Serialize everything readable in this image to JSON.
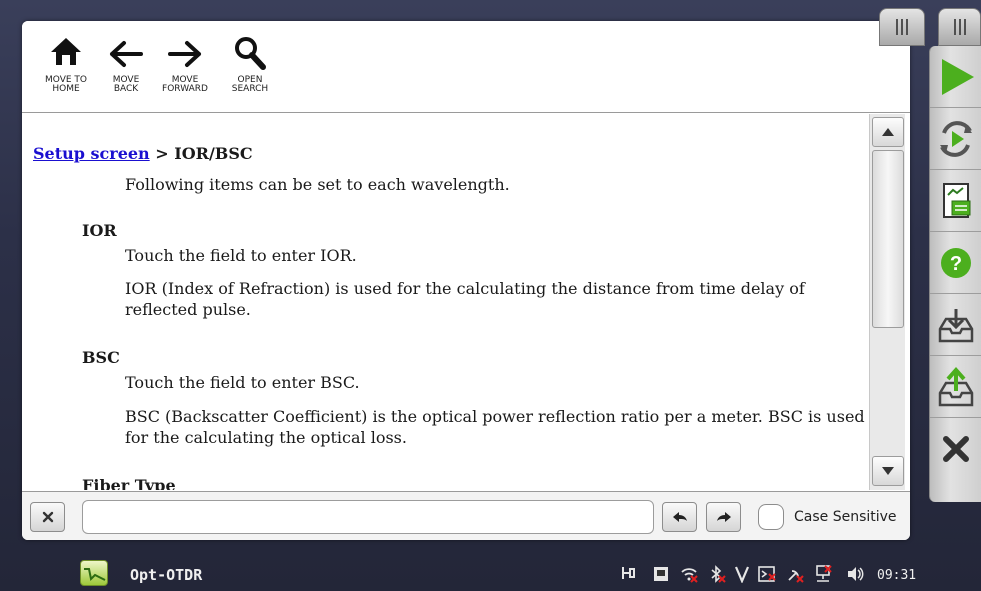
{
  "toolbar": {
    "home_label": "MOVE TO\nHOME",
    "back_label": "MOVE\nBACK",
    "forward_label": "MOVE\nFORWARD",
    "search_label": "OPEN\nSEARCH"
  },
  "content": {
    "breadcrumb_link": "Setup screen",
    "breadcrumb_rest": " > IOR/BSC",
    "intro": "Following items can be set to each wavelength.",
    "sections": [
      {
        "heading": "IOR",
        "lines": [
          "Touch the field to enter IOR.",
          "IOR (Index of Refraction) is used for the calculating the distance from time delay of",
          "reflected pulse."
        ]
      },
      {
        "heading": "BSC",
        "lines": [
          "Touch the field to enter BSC.",
          "BSC (Backscatter Coefficient) is the optical power reflection ratio per a meter. BSC is used",
          "for the calculating the optical loss."
        ]
      },
      {
        "heading": "Fiber Type"
      }
    ]
  },
  "find_bar": {
    "search_value": "",
    "case_sensitive_label": "Case Sensitive",
    "case_sensitive_checked": false
  },
  "side_panel": {
    "buttons": [
      "play-icon",
      "replay-icon",
      "report-icon",
      "help-icon",
      "load-icon",
      "save-icon",
      "close-icon"
    ]
  },
  "taskbar": {
    "app_name": "Opt-OTDR",
    "clock": "09:31"
  },
  "colors": {
    "link": "#1a0fd0",
    "accent_green": "#4caf1e",
    "desktop": "#2c3048"
  }
}
